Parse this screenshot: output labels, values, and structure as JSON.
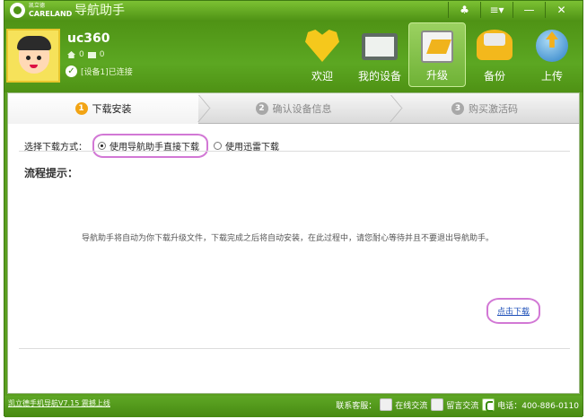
{
  "app": {
    "logo_top": "凯立德",
    "logo_en": "CARELAND",
    "title": "导航助手",
    "window_controls": [
      "♣",
      "≡▾",
      "—",
      "✕"
    ]
  },
  "user": {
    "name": "uc360",
    "home_count": "0",
    "mail_count": "0",
    "device_status": "[设备1]已连接"
  },
  "nav": {
    "items": [
      {
        "label": "欢迎",
        "icon": "heart-icon"
      },
      {
        "label": "我的设备",
        "icon": "device-icon"
      },
      {
        "label": "升级",
        "icon": "upgrade-icon"
      },
      {
        "label": "备份",
        "icon": "backup-icon"
      },
      {
        "label": "上传",
        "icon": "upload-icon"
      }
    ],
    "active": "升级"
  },
  "steps": [
    {
      "num": "1",
      "label": "下载安装"
    },
    {
      "num": "2",
      "label": "确认设备信息"
    },
    {
      "num": "3",
      "label": "购买激活码"
    }
  ],
  "download": {
    "method_label": "选择下载方式：",
    "option_direct": "使用导航助手直接下载",
    "option_thunder": "使用迅雷下载",
    "selected": "使用导航助手直接下载"
  },
  "flow": {
    "title": "流程提示：",
    "text": "导航助手将自动为你下载升级文件，下载完成之后将自动安装，在此过程中，请您耐心等待并且不要退出导航助手。",
    "link": "点击下载"
  },
  "footer": {
    "marquee": "凯立德手机导航V7.15 震撼上线",
    "contact_label": "联系客服：",
    "online_service": "在线交流",
    "message_service": "留言交流",
    "hotline": "电话：400-886-0110"
  },
  "colors": {
    "brand_green": "#5a9e1f",
    "accent_orange": "#f2a414",
    "highlight_pink": "#d278d5",
    "link_blue": "#1d4fb8"
  }
}
